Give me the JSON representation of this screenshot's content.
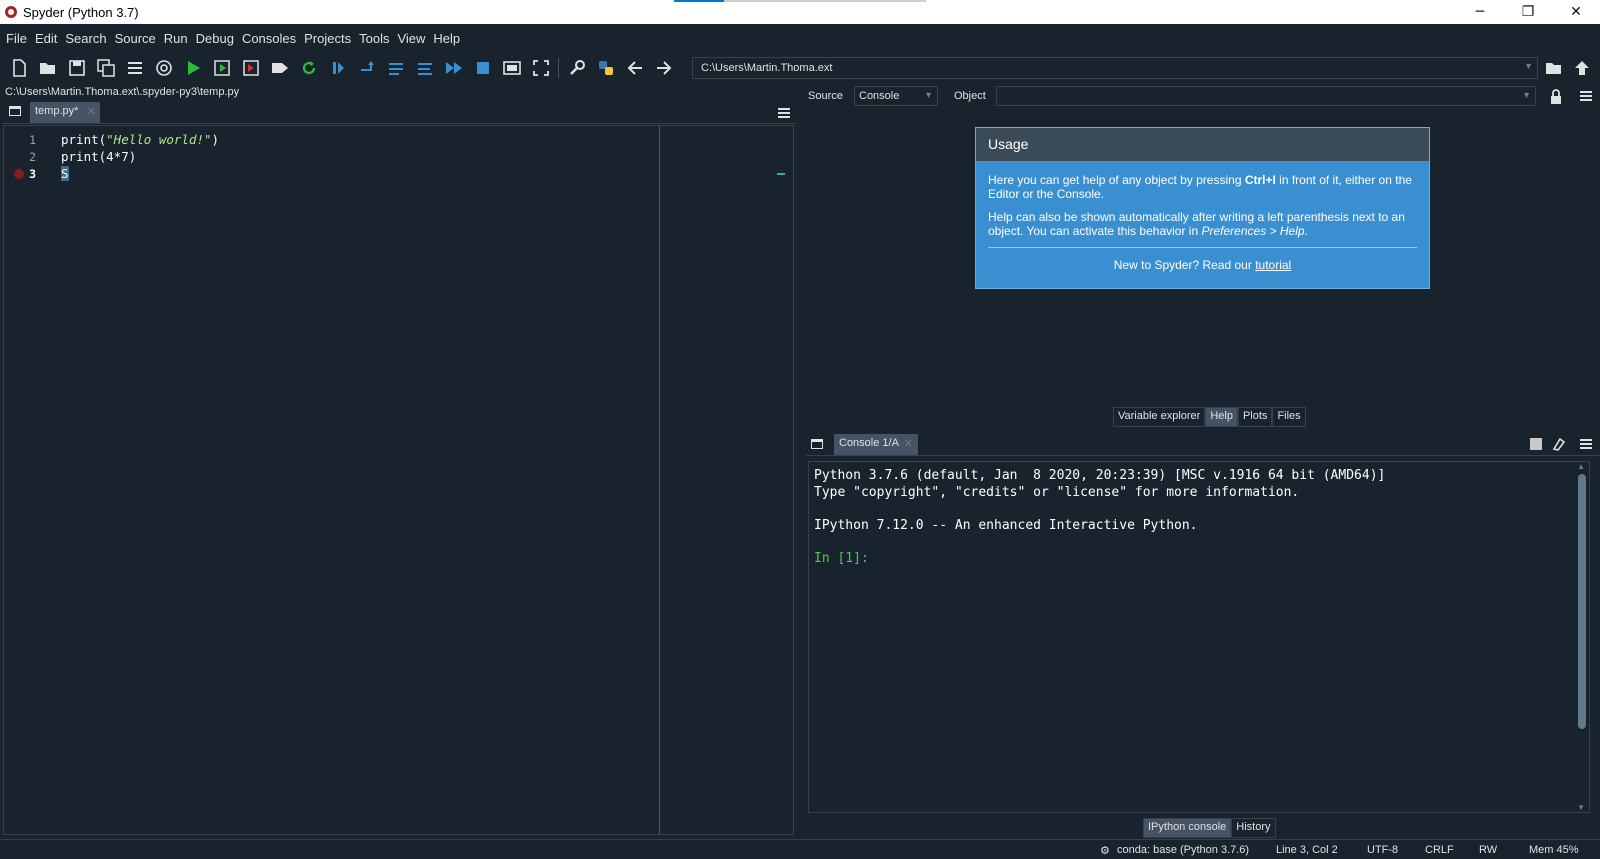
{
  "window": {
    "title": "Spyder (Python 3.7)",
    "min": "─",
    "max": "❐",
    "close": "✕"
  },
  "menu": [
    "File",
    "Edit",
    "Search",
    "Source",
    "Run",
    "Debug",
    "Consoles",
    "Projects",
    "Tools",
    "View",
    "Help"
  ],
  "toolbar": {
    "path": "C:\\Users\\Martin.Thoma.ext",
    "icons": [
      "new-file-icon",
      "open-file-icon",
      "save-icon",
      "save-all-icon",
      "outline-icon",
      "at-icon",
      "run-icon",
      "run-cell-icon",
      "run-cell-advance-icon",
      "run-selection-icon",
      "rerun-icon",
      "debug-icon",
      "step-icon",
      "step-into-icon",
      "step-return-icon",
      "continue-icon",
      "stop-icon",
      "maximize-pane-icon",
      "fullscreen-icon",
      "preferences-icon",
      "python-path-icon",
      "back-arrow-icon",
      "forward-arrow-icon",
      "browse-folder-icon",
      "parent-dir-icon"
    ]
  },
  "editor": {
    "file_path": "C:\\Users\\Martin.Thoma.ext\\.spyder-py3\\temp.py",
    "tab": "temp.py*",
    "lines": [
      {
        "no": "1",
        "pre": "print(",
        "str": "\"Hello world!\"",
        "post": ")"
      },
      {
        "no": "2",
        "pre": "print(4*7)",
        "str": "",
        "post": ""
      },
      {
        "no": "3",
        "pre": "S",
        "str": "",
        "post": ""
      }
    ]
  },
  "help": {
    "source_label": "Source",
    "source_value": "Console",
    "object_label": "Object",
    "usage_title": "Usage",
    "p1_a": "Here you can get help of any object by pressing ",
    "p1_key": "Ctrl+I",
    "p1_b": " in front of it, either on the Editor or the Console.",
    "p2_a": "Help can also be shown automatically after writing a left parenthesis next to an object. You can activate this behavior in ",
    "p2_em": "Preferences > Help",
    "p2_b": ".",
    "new_text": "New to Spyder? Read our ",
    "tutorial": "tutorial",
    "tabs": [
      "Variable explorer",
      "Help",
      "Plots",
      "Files"
    ]
  },
  "console": {
    "tab": "Console 1/A",
    "lines": [
      "Python 3.7.6 (default, Jan  8 2020, 20:23:39) [MSC v.1916 64 bit (AMD64)]",
      "Type \"copyright\", \"credits\" or \"license\" for more information.",
      "",
      "IPython 7.12.0 -- An enhanced Interactive Python."
    ],
    "prompt": "In [1]:",
    "tabs": [
      "IPython console",
      "History"
    ]
  },
  "status": {
    "conda": "conda: base (Python 3.7.6)",
    "position": "Line 3, Col 2",
    "encoding": "UTF-8",
    "eol": "CRLF",
    "mode": "RW",
    "mem": "Mem 45%"
  }
}
